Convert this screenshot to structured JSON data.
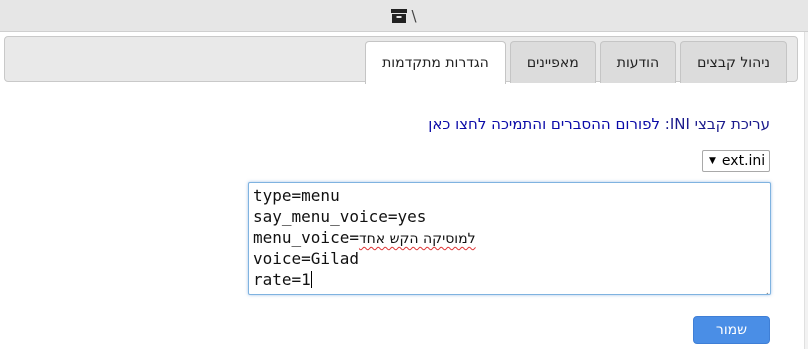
{
  "topbar": {
    "separator": "\\",
    "folder_icon": "archive-box-icon"
  },
  "tabs": [
    {
      "label": "ניהול קבצים",
      "active": false
    },
    {
      "label": "הודעות",
      "active": false
    },
    {
      "label": "מאפיינים",
      "active": false
    },
    {
      "label": "הגדרות מתקדמות",
      "active": true
    }
  ],
  "info": {
    "prefix": "עריכת קבצי INI:",
    "link_text": "לפורום ההסברים והתמיכה לחצו כאן"
  },
  "file_select": {
    "selected": "ext.ini"
  },
  "editor": {
    "lines": [
      "type=menu",
      "say_menu_voice=yes",
      "menu_voice=",
      "voice=Gilad",
      "rate=1"
    ],
    "line3_hebrew": "למוסיקה הקש אחד"
  },
  "save_button": {
    "label": "שמור"
  },
  "colors": {
    "tab_bg": "#dcdcdc",
    "active_tab_bg": "#ffffff",
    "info_text": "#1a1a8c",
    "save_button_bg": "#4a8ee6",
    "editor_focus_border": "#7fb3e0"
  }
}
